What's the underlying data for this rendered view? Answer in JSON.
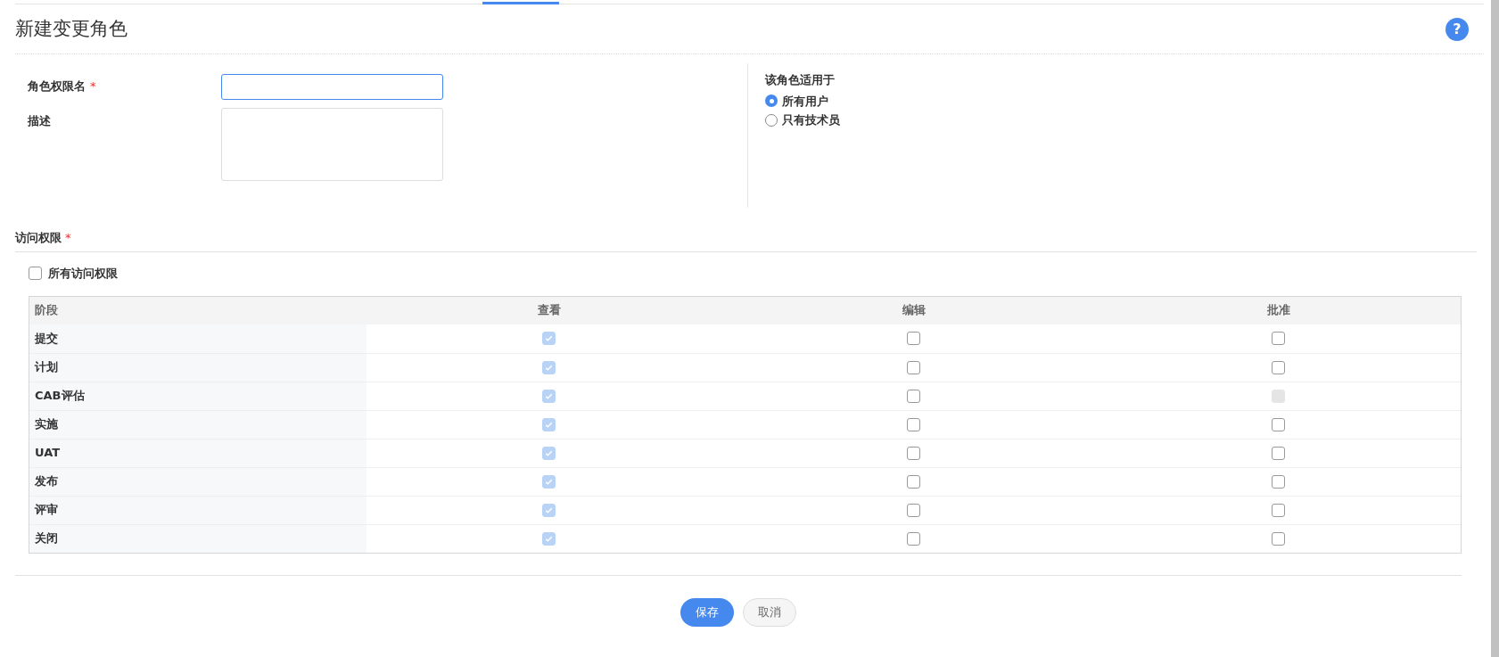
{
  "page": {
    "title": "新建变更角色",
    "help_icon": "?"
  },
  "form": {
    "name_label": "角色权限名",
    "name_required_mark": "*",
    "name_focused": true,
    "description_label": "描述"
  },
  "applies_to": {
    "label": "该角色适用于",
    "options": [
      {
        "label": "所有用户",
        "selected": true
      },
      {
        "label": "只有技术员",
        "selected": false
      }
    ]
  },
  "access": {
    "label": "访问权限",
    "required_mark": "*",
    "all_label": "所有访问权限",
    "all_checked": false
  },
  "table": {
    "columns": [
      "阶段",
      "查看",
      "编辑",
      "批准"
    ],
    "rows": [
      {
        "stage": "提交",
        "cells": [
          {
            "checked": true,
            "disabled": true
          },
          {
            "checked": false,
            "disabled": false
          },
          {
            "checked": false,
            "disabled": false
          }
        ]
      },
      {
        "stage": "计划",
        "cells": [
          {
            "checked": true,
            "disabled": true
          },
          {
            "checked": false,
            "disabled": false
          },
          {
            "checked": false,
            "disabled": false
          }
        ]
      },
      {
        "stage": "CAB评估",
        "cells": [
          {
            "checked": true,
            "disabled": true
          },
          {
            "checked": false,
            "disabled": false
          },
          {
            "checked": false,
            "disabled": true
          }
        ]
      },
      {
        "stage": "实施",
        "cells": [
          {
            "checked": true,
            "disabled": true
          },
          {
            "checked": false,
            "disabled": false
          },
          {
            "checked": false,
            "disabled": false
          }
        ]
      },
      {
        "stage": "UAT",
        "cells": [
          {
            "checked": true,
            "disabled": true
          },
          {
            "checked": false,
            "disabled": false
          },
          {
            "checked": false,
            "disabled": false
          }
        ]
      },
      {
        "stage": "发布",
        "cells": [
          {
            "checked": true,
            "disabled": true
          },
          {
            "checked": false,
            "disabled": false
          },
          {
            "checked": false,
            "disabled": false
          }
        ]
      },
      {
        "stage": "评审",
        "cells": [
          {
            "checked": true,
            "disabled": true
          },
          {
            "checked": false,
            "disabled": false
          },
          {
            "checked": false,
            "disabled": false
          }
        ]
      },
      {
        "stage": "关闭",
        "cells": [
          {
            "checked": true,
            "disabled": true
          },
          {
            "checked": false,
            "disabled": false
          },
          {
            "checked": false,
            "disabled": false
          }
        ]
      }
    ]
  },
  "buttons": [
    {
      "label": "保存",
      "kind": "primary"
    },
    {
      "label": "取消",
      "kind": "secondary"
    }
  ]
}
